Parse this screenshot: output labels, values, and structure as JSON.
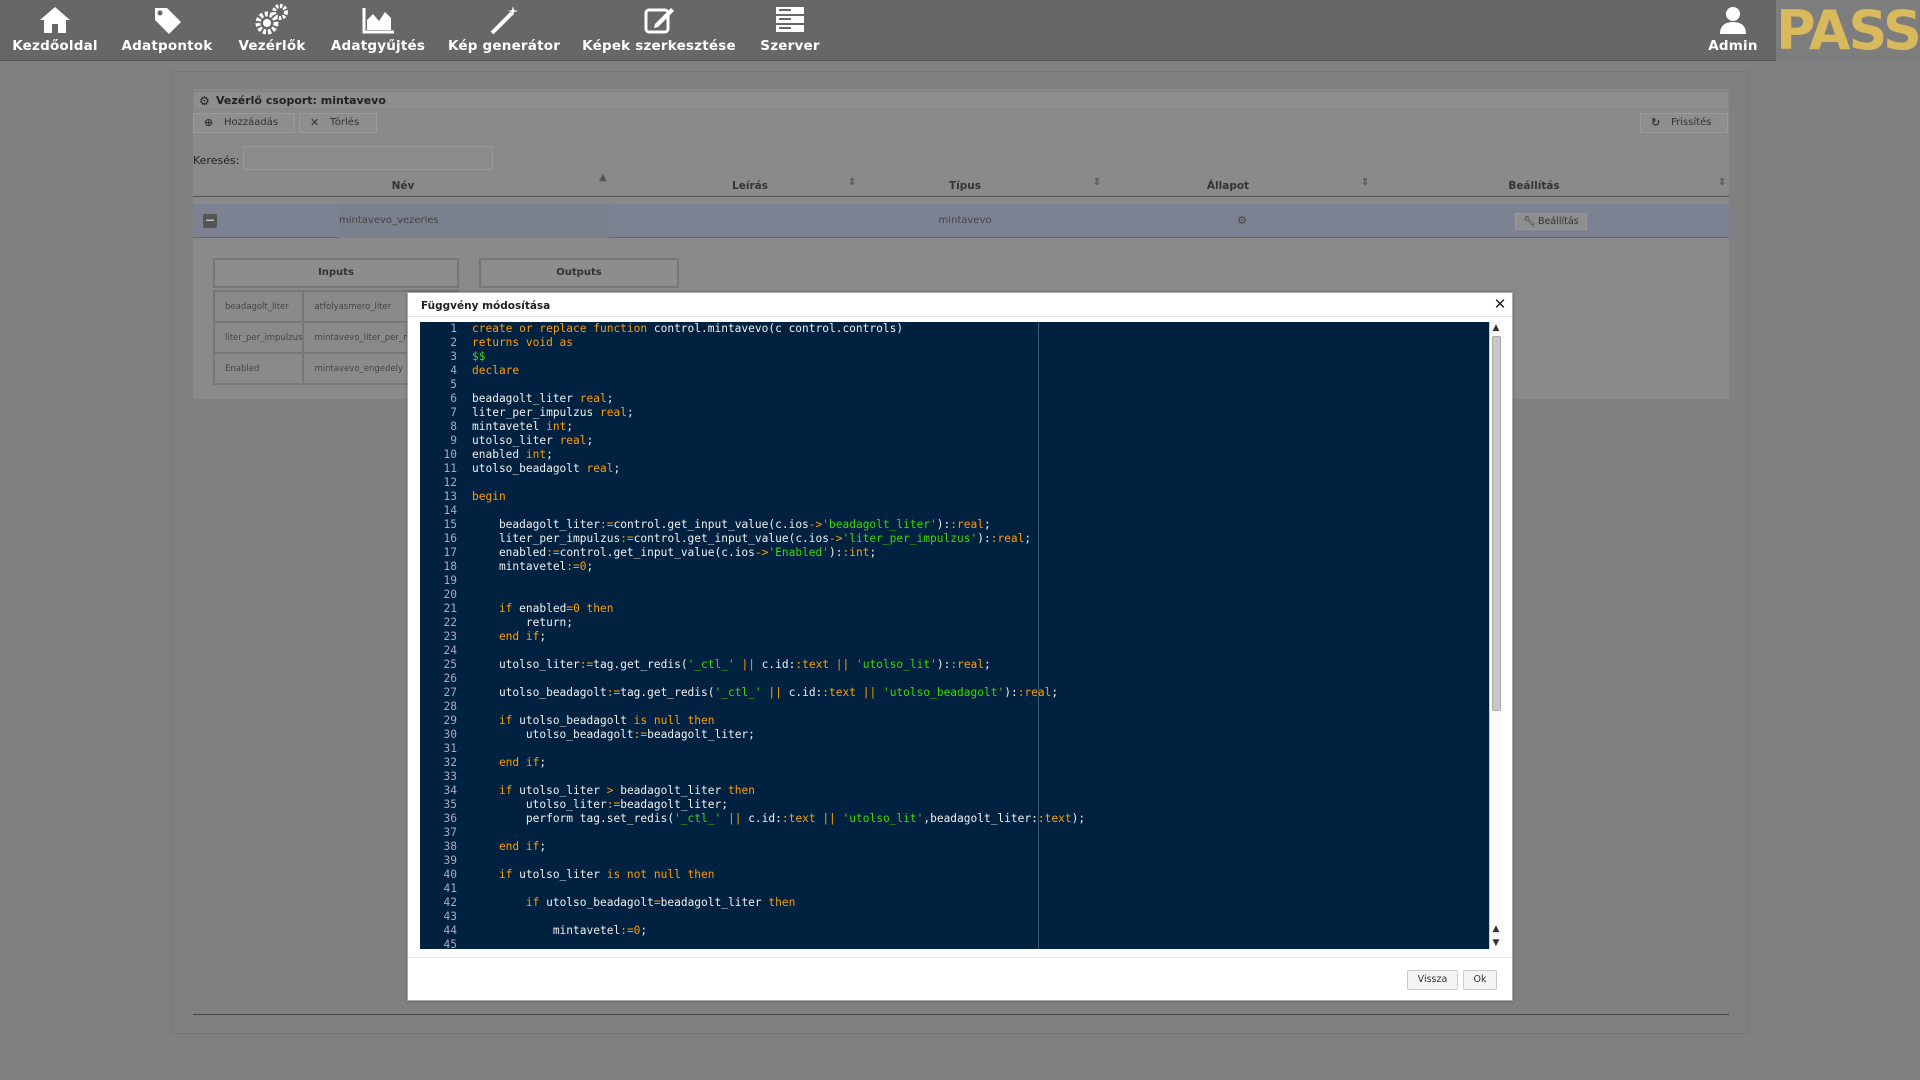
{
  "nav": {
    "items": [
      {
        "label": "Kezdőoldal",
        "icon": "home-icon"
      },
      {
        "label": "Adatpontok",
        "icon": "tag-icon"
      },
      {
        "label": "Vezérlők",
        "icon": "gears-icon"
      },
      {
        "label": "Adatgyűjtés",
        "icon": "area-chart-icon"
      },
      {
        "label": "Kép generátor",
        "icon": "magic-wand-icon"
      },
      {
        "label": "Képek szerkesztése",
        "icon": "edit-icon"
      },
      {
        "label": "Szerver",
        "icon": "server-icon"
      }
    ],
    "admin_label": "Admin",
    "logo_text": "PASS",
    "logo_color": "#d8b95c"
  },
  "panel": {
    "title": "Vezérlő csoport: mintavevo",
    "add_label": "Hozzáadás",
    "delete_label": "Törlés",
    "refresh_label": "Frissítés",
    "search_label": "Keresés:",
    "search_value": "",
    "columns": [
      "Név",
      "Leírás",
      "Típus",
      "Állapot",
      "Beállítás"
    ],
    "row": {
      "name": "mintavevo_vezerles",
      "description": "",
      "type": "mintavevo",
      "status_icon": "gear-icon",
      "settings_label": "Beállítás"
    },
    "io": {
      "inputs_label": "Inputs",
      "outputs_label": "Outputs",
      "rows": [
        [
          "beadagolt_liter",
          "atfolyasmero_liter"
        ],
        [
          "liter_per_impulzus",
          "mintavevo_liter_per_mintave"
        ],
        [
          "Enabled",
          "mintavevo_engedely"
        ]
      ]
    }
  },
  "modal": {
    "title": "Függvény módosítása",
    "back_label": "Vissza",
    "ok_label": "Ok",
    "code_lines": [
      [
        [
          "kw",
          "create or replace function "
        ],
        [
          "t",
          "control.mintavevo(c control.controls)"
        ]
      ],
      [
        [
          "kw",
          "returns void as"
        ]
      ],
      [
        [
          "str",
          "$$"
        ]
      ],
      [
        [
          "kw",
          "declare"
        ]
      ],
      [],
      [
        [
          "t",
          "beadagolt_liter "
        ],
        [
          "kw",
          "real"
        ],
        [
          "t",
          ";"
        ]
      ],
      [
        [
          "t",
          "liter_per_impulzus "
        ],
        [
          "kw",
          "real"
        ],
        [
          "t",
          ";"
        ]
      ],
      [
        [
          "t",
          "mintavetel "
        ],
        [
          "kw",
          "int"
        ],
        [
          "t",
          ";"
        ]
      ],
      [
        [
          "t",
          "utolso_liter "
        ],
        [
          "kw",
          "real"
        ],
        [
          "t",
          ";"
        ]
      ],
      [
        [
          "t",
          "enabled "
        ],
        [
          "kw",
          "int"
        ],
        [
          "t",
          ";"
        ]
      ],
      [
        [
          "t",
          "utolso_beadagolt "
        ],
        [
          "kw",
          "real"
        ],
        [
          "t",
          ";"
        ]
      ],
      [],
      [
        [
          "kw",
          "begin"
        ]
      ],
      [],
      [
        [
          "t",
          "    beadagolt_liter"
        ],
        [
          "op",
          ":="
        ],
        [
          "t",
          "control.get_input_value(c.ios"
        ],
        [
          "op",
          "->"
        ],
        [
          "str",
          "'beadagolt_liter'"
        ],
        [
          "t",
          "):"
        ],
        [
          "op",
          ":"
        ],
        [
          "kw",
          "real"
        ],
        [
          "t",
          ";"
        ]
      ],
      [
        [
          "t",
          "    liter_per_impulzus"
        ],
        [
          "op",
          ":="
        ],
        [
          "t",
          "control.get_input_value(c.ios"
        ],
        [
          "op",
          "->"
        ],
        [
          "str",
          "'liter_per_impulzus'"
        ],
        [
          "t",
          "):"
        ],
        [
          "op",
          ":"
        ],
        [
          "kw",
          "real"
        ],
        [
          "t",
          ";"
        ]
      ],
      [
        [
          "t",
          "    enabled"
        ],
        [
          "op",
          ":="
        ],
        [
          "t",
          "control.get_input_value(c.ios"
        ],
        [
          "op",
          "->"
        ],
        [
          "str",
          "'Enabled'"
        ],
        [
          "t",
          "):"
        ],
        [
          "op",
          ":"
        ],
        [
          "kw",
          "int"
        ],
        [
          "t",
          ";"
        ]
      ],
      [
        [
          "t",
          "    mintavetel"
        ],
        [
          "op",
          ":="
        ],
        [
          "kw",
          "0"
        ],
        [
          "t",
          ";"
        ]
      ],
      [],
      [],
      [
        [
          "kw",
          "    if "
        ],
        [
          "t",
          "enabled"
        ],
        [
          "op",
          "="
        ],
        [
          "kw",
          "0 then"
        ]
      ],
      [
        [
          "t",
          "        return;"
        ]
      ],
      [
        [
          "kw",
          "    end if"
        ],
        [
          "t",
          ";"
        ]
      ],
      [],
      [
        [
          "t",
          "    utolso_liter"
        ],
        [
          "op",
          ":="
        ],
        [
          "t",
          "tag.get_redis("
        ],
        [
          "str",
          "'_ctl_'"
        ],
        [
          "kw",
          " || "
        ],
        [
          "t",
          "c.id:"
        ],
        [
          "op",
          ":"
        ],
        [
          "kw",
          "text"
        ],
        [
          "kw",
          " || "
        ],
        [
          "str",
          "'utolso_lit'"
        ],
        [
          "t",
          "):"
        ],
        [
          "op",
          ":"
        ],
        [
          "kw",
          "real"
        ],
        [
          "t",
          ";"
        ]
      ],
      [],
      [
        [
          "t",
          "    utolso_beadagolt"
        ],
        [
          "op",
          ":="
        ],
        [
          "t",
          "tag.get_redis("
        ],
        [
          "str",
          "'_ctl_'"
        ],
        [
          "kw",
          " || "
        ],
        [
          "t",
          "c.id:"
        ],
        [
          "op",
          ":"
        ],
        [
          "kw",
          "text"
        ],
        [
          "kw",
          " || "
        ],
        [
          "str",
          "'utolso_beadagolt'"
        ],
        [
          "t",
          "):"
        ],
        [
          "op",
          ":"
        ],
        [
          "kw",
          "real"
        ],
        [
          "t",
          ";"
        ]
      ],
      [],
      [
        [
          "kw",
          "    if "
        ],
        [
          "t",
          "utolso_beadagolt "
        ],
        [
          "kw",
          "is null then"
        ]
      ],
      [
        [
          "t",
          "        utolso_beadagolt"
        ],
        [
          "op",
          ":="
        ],
        [
          "t",
          "beadagolt_liter;"
        ]
      ],
      [],
      [
        [
          "kw",
          "    end if"
        ],
        [
          "t",
          ";"
        ]
      ],
      [],
      [
        [
          "kw",
          "    if "
        ],
        [
          "t",
          "utolso_liter "
        ],
        [
          "op",
          "> "
        ],
        [
          "t",
          "beadagolt_liter "
        ],
        [
          "kw",
          "then"
        ]
      ],
      [
        [
          "t",
          "        utolso_liter"
        ],
        [
          "op",
          ":="
        ],
        [
          "t",
          "beadagolt_liter;"
        ]
      ],
      [
        [
          "t",
          "        perform tag.set_redis("
        ],
        [
          "str",
          "'_ctl_'"
        ],
        [
          "kw",
          " || "
        ],
        [
          "t",
          "c.id:"
        ],
        [
          "op",
          ":"
        ],
        [
          "kw",
          "text"
        ],
        [
          "kw",
          " || "
        ],
        [
          "str",
          "'utolso_lit'"
        ],
        [
          "t",
          ",beadagolt_liter:"
        ],
        [
          "op",
          ":"
        ],
        [
          "kw",
          "text"
        ],
        [
          "t",
          ");"
        ]
      ],
      [],
      [
        [
          "kw",
          "    end if"
        ],
        [
          "t",
          ";"
        ]
      ],
      [],
      [
        [
          "kw",
          "    if "
        ],
        [
          "t",
          "utolso_liter "
        ],
        [
          "kw",
          "is not null then"
        ]
      ],
      [],
      [
        [
          "kw",
          "        if "
        ],
        [
          "t",
          "utolso_beadagolt"
        ],
        [
          "op",
          "="
        ],
        [
          "t",
          "beadagolt_liter "
        ],
        [
          "kw",
          "then"
        ]
      ],
      [],
      [
        [
          "t",
          "            mintavetel"
        ],
        [
          "op",
          ":="
        ],
        [
          "kw",
          "0"
        ],
        [
          "t",
          ";"
        ]
      ],
      []
    ],
    "line_numbers": [
      "1",
      "2",
      "3",
      "4",
      "5",
      "6",
      "7",
      "8",
      "9",
      "10",
      "11",
      "12",
      "13",
      "14",
      "15",
      "16",
      "17",
      "18",
      "19",
      "20",
      "21",
      "22",
      "23",
      "24",
      "25",
      "26",
      "27",
      "28",
      "29",
      "30",
      "31",
      "32",
      "33",
      "34",
      "35",
      "36",
      "37",
      "38",
      "39",
      "40",
      "41",
      "42",
      "43",
      "44",
      "45"
    ]
  }
}
